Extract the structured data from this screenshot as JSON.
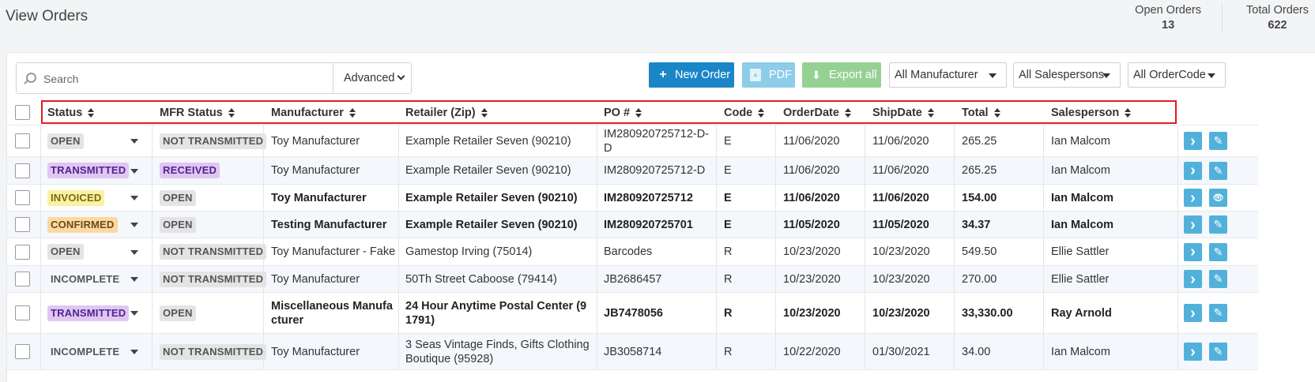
{
  "header": {
    "title": "View Orders",
    "open_orders_label": "Open Orders",
    "open_orders_value": "13",
    "total_orders_label": "Total Orders",
    "total_orders_value": "622"
  },
  "toolbar": {
    "search_placeholder": "Search",
    "advanced_label": "Advanced",
    "new_order_label": "New Order",
    "pdf_label": "PDF",
    "export_label": "Export all",
    "manufacturer_filter": "All Manufacturer",
    "salesperson_filter": "All Salespersons",
    "ordercode_filter": "All OrderCode"
  },
  "colors": {
    "primary": "#1a86c8",
    "pdf_disabled": "#8dcde8",
    "export_disabled": "#95d193",
    "highlight_border": "#e01c22",
    "action_button": "#52b1db"
  },
  "table": {
    "columns": [
      "Status",
      "MFR Status",
      "Manufacturer",
      "Retailer (Zip)",
      "PO #",
      "Code",
      "OrderDate",
      "ShipDate",
      "Total",
      "Salesperson"
    ],
    "rows": [
      {
        "status": "OPEN",
        "status_style": "open",
        "mfr": "NOT TRANSMITTED",
        "mfr_style": "nt",
        "manufacturer": "Toy Manufacturer",
        "retailer": "Example Retailer Seven (90210)",
        "po": "IM280920725712-D-D",
        "code": "E",
        "order_date": "11/06/2020",
        "ship_date": "11/06/2020",
        "total": "265.25",
        "salesperson": "Ian Malcom",
        "bold": false,
        "action": "edit-icon"
      },
      {
        "status": "TRANSMITTED",
        "status_style": "trans",
        "mfr": "RECEIVED",
        "mfr_style": "recv",
        "manufacturer": "Toy Manufacturer",
        "retailer": "Example Retailer Seven (90210)",
        "po": "IM280920725712-D",
        "code": "E",
        "order_date": "11/06/2020",
        "ship_date": "11/06/2020",
        "total": "265.25",
        "salesperson": "Ian Malcom",
        "bold": false,
        "action": "edit-icon"
      },
      {
        "status": "INVOICED",
        "status_style": "inv",
        "mfr": "OPEN",
        "mfr_style": "open",
        "manufacturer": "Toy Manufacturer",
        "retailer": "Example Retailer Seven (90210)",
        "po": "IM280920725712",
        "code": "E",
        "order_date": "11/06/2020",
        "ship_date": "11/06/2020",
        "total": "154.00",
        "salesperson": "Ian Malcom",
        "bold": true,
        "action": "eye-icon"
      },
      {
        "status": "CONFIRMED",
        "status_style": "conf",
        "mfr": "OPEN",
        "mfr_style": "open",
        "manufacturer": "Testing Manufacturer",
        "retailer": "Example Retailer Seven (90210)",
        "po": "IM280920725701",
        "code": "E",
        "order_date": "11/05/2020",
        "ship_date": "11/05/2020",
        "total": "34.37",
        "salesperson": "Ian Malcom",
        "bold": true,
        "action": "edit-icon"
      },
      {
        "status": "OPEN",
        "status_style": "open",
        "mfr": "NOT TRANSMITTED",
        "mfr_style": "nt",
        "manufacturer": "Toy Manufacturer - Fake",
        "retailer": "Gamestop Irving (75014)",
        "po": "Barcodes",
        "code": "R",
        "order_date": "10/23/2020",
        "ship_date": "10/23/2020",
        "total": "549.50",
        "salesperson": "Ellie Sattler",
        "bold": false,
        "action": "edit-icon"
      },
      {
        "status": "INCOMPLETE",
        "status_style": "inc",
        "mfr": "NOT TRANSMITTED",
        "mfr_style": "nt",
        "manufacturer": "Toy Manufacturer",
        "retailer": "50Th Street Caboose (79414)",
        "po": "JB2686457",
        "code": "R",
        "order_date": "10/23/2020",
        "ship_date": "10/23/2020",
        "total": "270.00",
        "salesperson": "Ellie Sattler",
        "bold": false,
        "action": "edit-icon"
      },
      {
        "status": "TRANSMITTED",
        "status_style": "trans",
        "mfr": "OPEN",
        "mfr_style": "open",
        "manufacturer": "Miscellaneous Manufacturer",
        "retailer": "24 Hour Anytime Postal Center (91791)",
        "po": "JB7478056",
        "code": "R",
        "order_date": "10/23/2020",
        "ship_date": "10/23/2020",
        "total": "33,330.00",
        "salesperson": "Ray Arnold",
        "bold": true,
        "action": "edit-icon"
      },
      {
        "status": "INCOMPLETE",
        "status_style": "inc",
        "mfr": "NOT TRANSMITTED",
        "mfr_style": "nt",
        "manufacturer": "Toy Manufacturer",
        "retailer": "3 Seas Vintage Finds, Gifts Clothing Boutique (95928)",
        "po": "JB3058714",
        "code": "R",
        "order_date": "10/22/2020",
        "ship_date": "01/30/2021",
        "total": "34.00",
        "salesperson": "Ian Malcom",
        "bold": false,
        "action": "edit-icon"
      }
    ]
  }
}
